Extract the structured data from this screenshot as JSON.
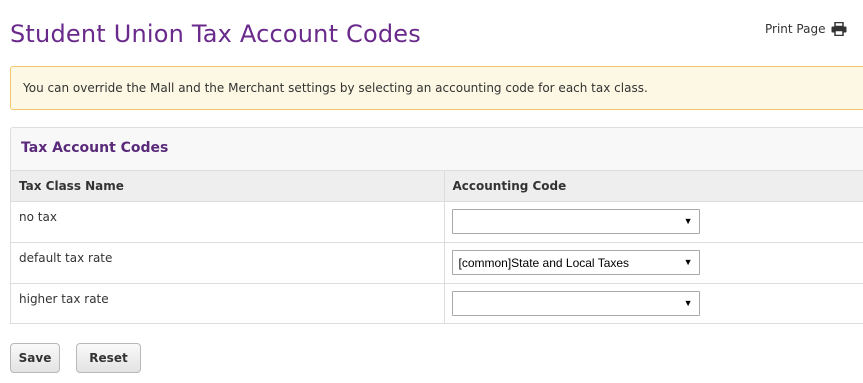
{
  "header": {
    "title": "Student Union Tax Account Codes",
    "print_label": "Print Page"
  },
  "notice": {
    "text": "You can override the Mall and the Merchant settings by selecting an accounting code for each tax class."
  },
  "panel": {
    "title": "Tax Account Codes",
    "columns": [
      "Tax Class Name",
      "Accounting Code"
    ],
    "rows": [
      {
        "name": "no tax",
        "selected": ""
      },
      {
        "name": "default tax rate",
        "selected": "[common]State and Local Taxes"
      },
      {
        "name": "higher tax rate",
        "selected": ""
      }
    ]
  },
  "actions": {
    "save_label": "Save",
    "reset_label": "Reset"
  },
  "icons": {
    "print": "printer-icon",
    "dropdown": "dropdown-arrow-icon"
  },
  "colors": {
    "title": "#6a2a8c",
    "notice_bg": "#fcf8e3",
    "notice_border": "#f5c66b"
  }
}
